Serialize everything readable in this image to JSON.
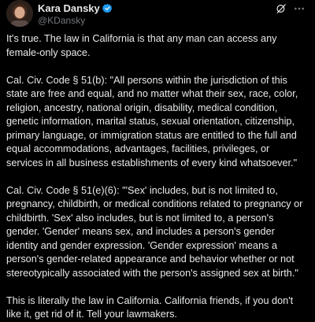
{
  "author": {
    "display_name": "Kara Dansky",
    "handle": "@KDansky",
    "verified": true,
    "verified_color": "#1d9bf0"
  },
  "icons": {
    "verified": "verified-badge-icon",
    "grok": "grok-icon",
    "more": "more-options-icon"
  },
  "post": {
    "paragraphs": [
      "It's true. The law in California is that any man can access any female-only space.",
      "Cal. Civ. Code § 51(b): \"All persons within the jurisdiction of this state are free and equal, and no matter what their sex, race, color, religion, ancestry, national origin, disability, medical condition, genetic information, marital status, sexual orientation, citizenship, primary language, or immigration status are entitled to the full and equal accommodations, advantages, facilities, privileges, or services in all business establishments of every kind whatsoever.\"",
      "Cal. Civ. Code § 51(e)(6): \"'Sex' includes, but is not limited to, pregnancy, childbirth, or medical conditions related to pregnancy or childbirth. 'Sex' also includes, but is not limited to, a person's gender. 'Gender' means sex, and includes a person's gender identity and gender expression. 'Gender expression' means a person's gender-related appearance and behavior whether or not stereotypically associated with the person's assigned sex at birth.\"",
      "This is literally the law in California. California friends, if you don't like it, get rid of it. Tell your lawmakers."
    ]
  },
  "colors": {
    "background": "#000000",
    "text": "#e7e9ea",
    "secondary": "#71767b"
  }
}
